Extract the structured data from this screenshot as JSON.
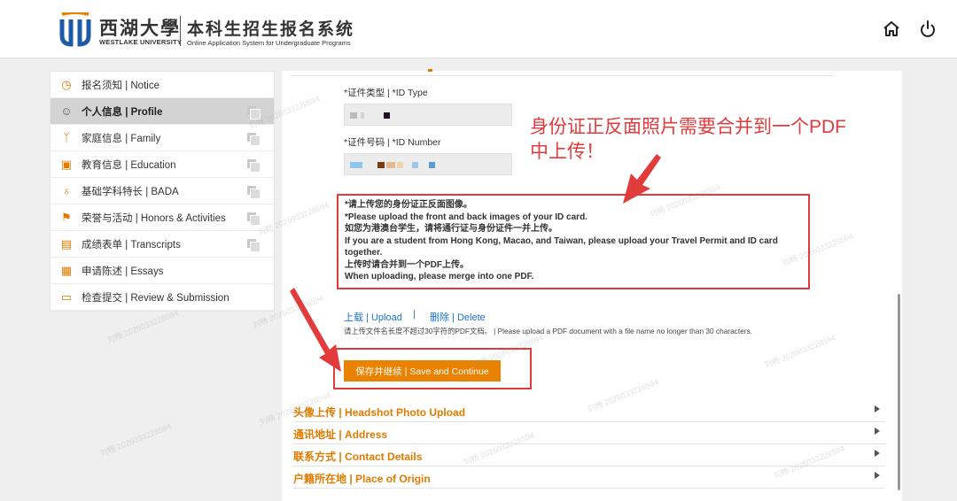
{
  "header": {
    "logo_cn": "西湖大學",
    "logo_en": "WESTLAKE UNIVERSITY",
    "system_cn": "本科生招生报名系统",
    "system_en": "Online Application System for Undergraduate Programs"
  },
  "sidebar": {
    "items": [
      {
        "label": "报名须知 | Notice",
        "icon": "clock-icon",
        "active": false
      },
      {
        "label": "个人信息 | Profile",
        "icon": "user-icon",
        "active": true
      },
      {
        "label": "家庭信息 | Family",
        "icon": "family-icon",
        "active": false
      },
      {
        "label": "教育信息 | Education",
        "icon": "education-icon",
        "active": false
      },
      {
        "label": "基础学科特长 | BADA",
        "icon": "medal-icon",
        "active": false
      },
      {
        "label": "荣誉与活动 | Honors & Activities",
        "icon": "running-icon",
        "active": false
      },
      {
        "label": "成绩表单 | Transcripts",
        "icon": "transcript-icon",
        "active": false
      },
      {
        "label": "申请陈述 | Essays",
        "icon": "essay-icon",
        "active": false
      },
      {
        "label": "检查提交 | Review & Submission",
        "icon": "review-icon",
        "active": false
      }
    ]
  },
  "form": {
    "id_type_label": "*证件类型 | *ID Type",
    "id_number_label": "*证件号码 | *ID Number",
    "notice_lines": [
      "*请上传您的身份证正反面图像。",
      "*Please upload the front and back images of your ID card.",
      "如您为港澳台学生，请将通行证与身份证件一并上传。",
      "If you are a student from Hong Kong, Macao, and Taiwan, please upload your Travel Permit and ID card together.",
      "上传时请合并到一个PDF上传。",
      "When uploading, please merge into one PDF."
    ],
    "upload_label": "上载 | Upload",
    "separator": "|",
    "delete_label": "删除 | Delete",
    "upload_hint": "请上传文件名长度不超过30字符的PDF文档。 | Please upload a PDF document with a file name no longer than 30 characters.",
    "save_label": "保存并继续 | Save and Continue"
  },
  "sections": [
    {
      "title": "头像上传 | Headshot Photo Upload"
    },
    {
      "title": "通讯地址 | Address"
    },
    {
      "title": "联系方式 | Contact Details"
    },
    {
      "title": "户籍所在地 | Place of Origin"
    }
  ],
  "annotation": {
    "line1": "身份证正反面照片需要合并到一个PDF",
    "line2": "中上传！"
  },
  "watermark": "刘畅 2026033228594",
  "colors": {
    "accent": "#e98200",
    "brand_blue": "#1f5aa8",
    "annotation_red": "#e23b3b",
    "link_blue": "#1a73c9"
  }
}
